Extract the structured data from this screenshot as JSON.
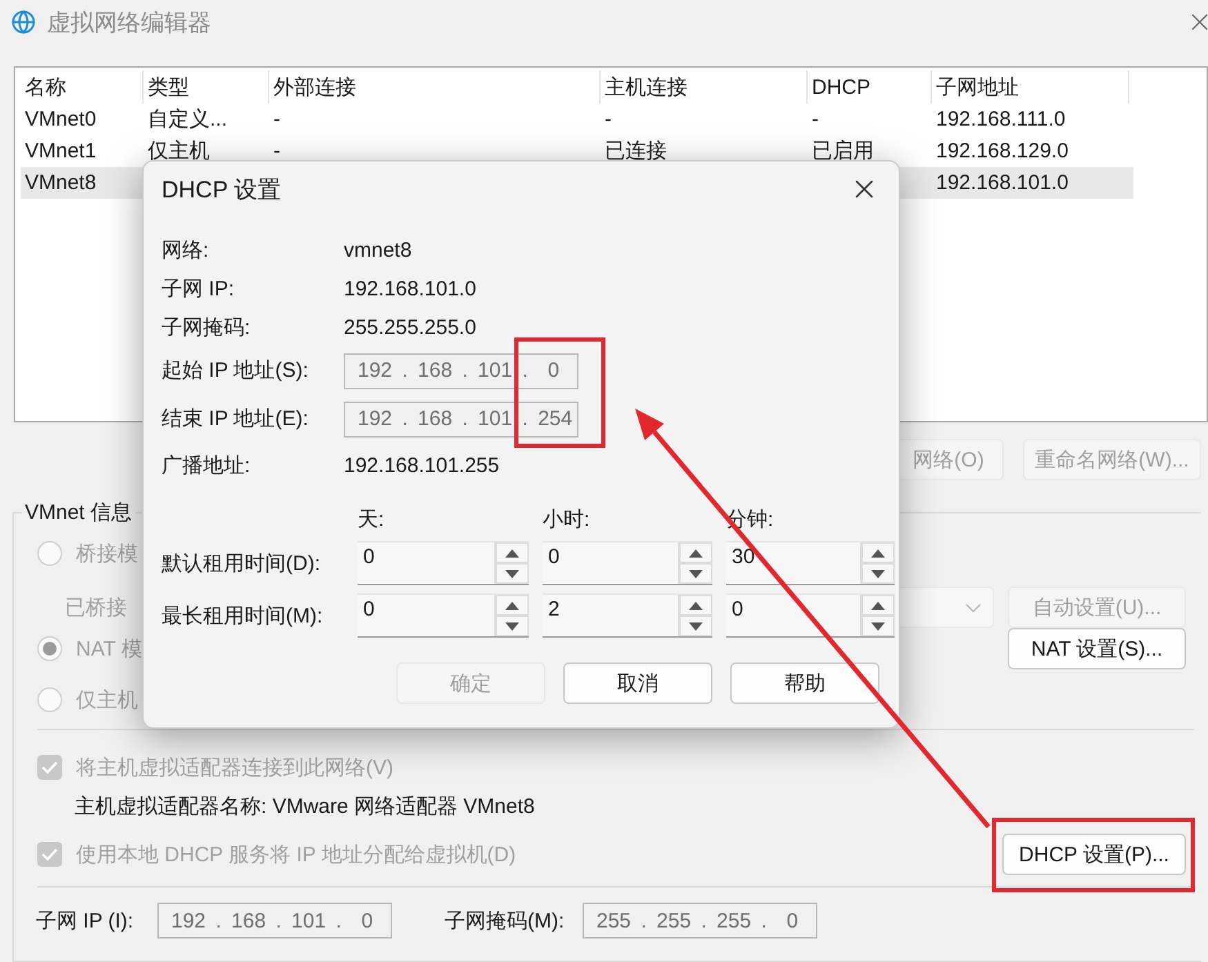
{
  "window": {
    "title": "虚拟网络编辑器"
  },
  "network_table": {
    "columns": [
      "名称",
      "类型",
      "外部连接",
      "主机连接",
      "DHCP",
      "子网地址"
    ],
    "rows": [
      {
        "selected": false,
        "name": "VMnet0",
        "type": "自定义...",
        "external": "-",
        "host": "-",
        "dhcp": "-",
        "subnet": "192.168.111.0"
      },
      {
        "selected": false,
        "name": "VMnet1",
        "type": "仅主机",
        "external": "-",
        "host": "已连接",
        "dhcp": "已启用",
        "subnet": "192.168.129.0"
      },
      {
        "selected": true,
        "name": "VMnet8",
        "subnet": "192.168.101.0"
      }
    ]
  },
  "network_buttons": [
    "网络(O)",
    "重命名网络(W)..."
  ],
  "vmnet_info": {
    "title": "VMnet 信息",
    "modes": [
      {
        "label": "桥接模",
        "selected": false,
        "disabled": true
      },
      {
        "label": "NAT 模",
        "selected": true,
        "disabled": true
      },
      {
        "label": "仅主机",
        "selected": false,
        "disabled": true
      }
    ],
    "bridged_to": {
      "label": "已桥接",
      "disabled": true
    },
    "auto_button": {
      "label": "自动设置(U)...",
      "disabled": true
    },
    "nat_button": {
      "label": "NAT 设置(S)...",
      "disabled": false
    },
    "connect_adapter": {
      "label": "将主机虚拟适配器连接到此网络(V)",
      "checked": true,
      "disabled": true
    },
    "adapter_name": "主机虚拟适配器名称: VMware 网络适配器 VMnet8",
    "use_dhcp": {
      "label": "使用本地 DHCP 服务将 IP 地址分配给虚拟机(D)",
      "checked": true,
      "disabled": true
    },
    "dhcp_button": {
      "label": "DHCP 设置(P)...",
      "disabled": false
    },
    "subnet_ip": {
      "label": "子网 IP (I):",
      "value": "192 . 168 . 101 .  0"
    },
    "subnet_mask": {
      "label": "子网掩码(M):",
      "value": "255 . 255 . 255 .  0"
    }
  },
  "dhcp_dialog": {
    "title": "DHCP 设置",
    "rows": [
      {
        "kind": "text",
        "label": "网络:",
        "value": "vmnet8"
      },
      {
        "kind": "text",
        "label": "子网 IP:",
        "value": "192.168.101.0"
      },
      {
        "kind": "text",
        "label": "子网掩码:",
        "value": "255.255.255.0"
      },
      {
        "kind": "field",
        "label": "起始 IP 地址(S):",
        "value": "192 . 168 . 101 .  0",
        "disabled": true
      },
      {
        "kind": "field",
        "label": "结束 IP 地址(E):",
        "value": "192 . 168 . 101 . 254",
        "disabled": true
      },
      {
        "kind": "text",
        "label": "广播地址:",
        "value": "192.168.101.255"
      }
    ],
    "lease_columns": [
      "天:",
      "小时:",
      "分钟:"
    ],
    "leases": [
      {
        "label": "默认租用时间(D):",
        "values": [
          "0",
          "0",
          "30"
        ]
      },
      {
        "label": "最长租用时间(M):",
        "values": [
          "0",
          "2",
          "0"
        ]
      }
    ],
    "buttons": [
      {
        "label": "确定",
        "disabled": true
      },
      {
        "label": "取消",
        "disabled": false
      },
      {
        "label": "帮助",
        "disabled": false
      }
    ]
  },
  "annotations": [
    {
      "kind": "box"
    },
    {
      "kind": "box"
    },
    {
      "kind": "arrow"
    }
  ]
}
